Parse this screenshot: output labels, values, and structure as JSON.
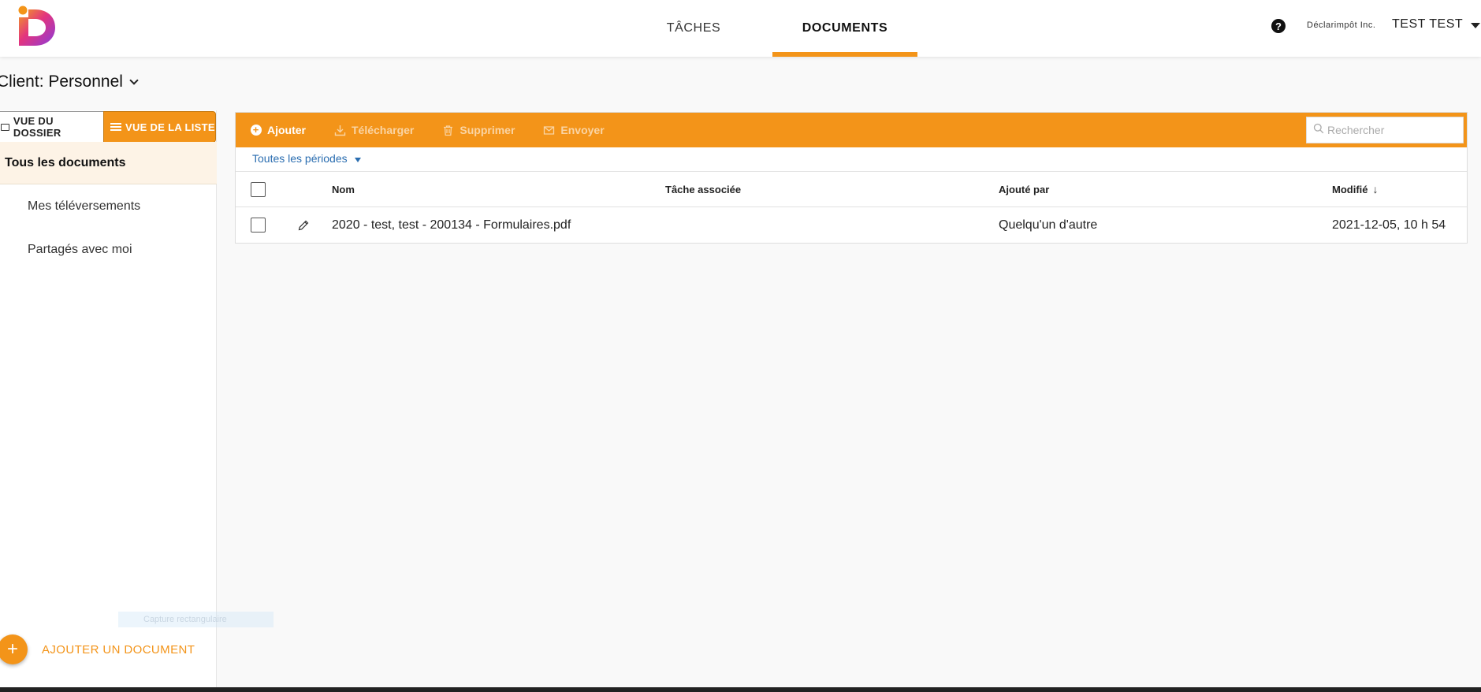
{
  "colors": {
    "accent": "#f39419",
    "link": "#2a6db0"
  },
  "header": {
    "nav": [
      {
        "label": "TÂCHES",
        "active": false
      },
      {
        "label": "DOCUMENTS",
        "active": true
      }
    ],
    "help_icon": "question-circle-icon",
    "company": "Déclarimpôt Inc.",
    "user": "TEST TEST"
  },
  "client": {
    "title": "Client: Personnel"
  },
  "sidebar": {
    "view_folder_label": "VUE DU DOSSIER",
    "view_list_label": "VUE DE LA LISTE",
    "items": [
      {
        "label": "Tous les documents",
        "active": true
      },
      {
        "label": "Mes téléversements",
        "active": false
      },
      {
        "label": "Partagés avec moi",
        "active": false
      }
    ],
    "add_document_label": "AJOUTER UN DOCUMENT"
  },
  "overlay": {
    "snip_label": "Capture rectangulaire"
  },
  "toolbar": {
    "add_label": "Ajouter",
    "download_label": "Télécharger",
    "delete_label": "Supprimer",
    "send_label": "Envoyer",
    "search_placeholder": "Rechercher"
  },
  "filter": {
    "period_label": "Toutes les périodes"
  },
  "table": {
    "columns": [
      "Nom",
      "Tâche associée",
      "Ajouté par",
      "Modifié"
    ],
    "sort": {
      "column": "Modifié",
      "direction": "desc"
    },
    "rows": [
      {
        "name": "2020 - test, test - 200134 - Formulaires.pdf",
        "task": "",
        "added_by": "Quelqu'un d'autre",
        "modified": "2021-12-05, 10 h 54"
      }
    ]
  }
}
